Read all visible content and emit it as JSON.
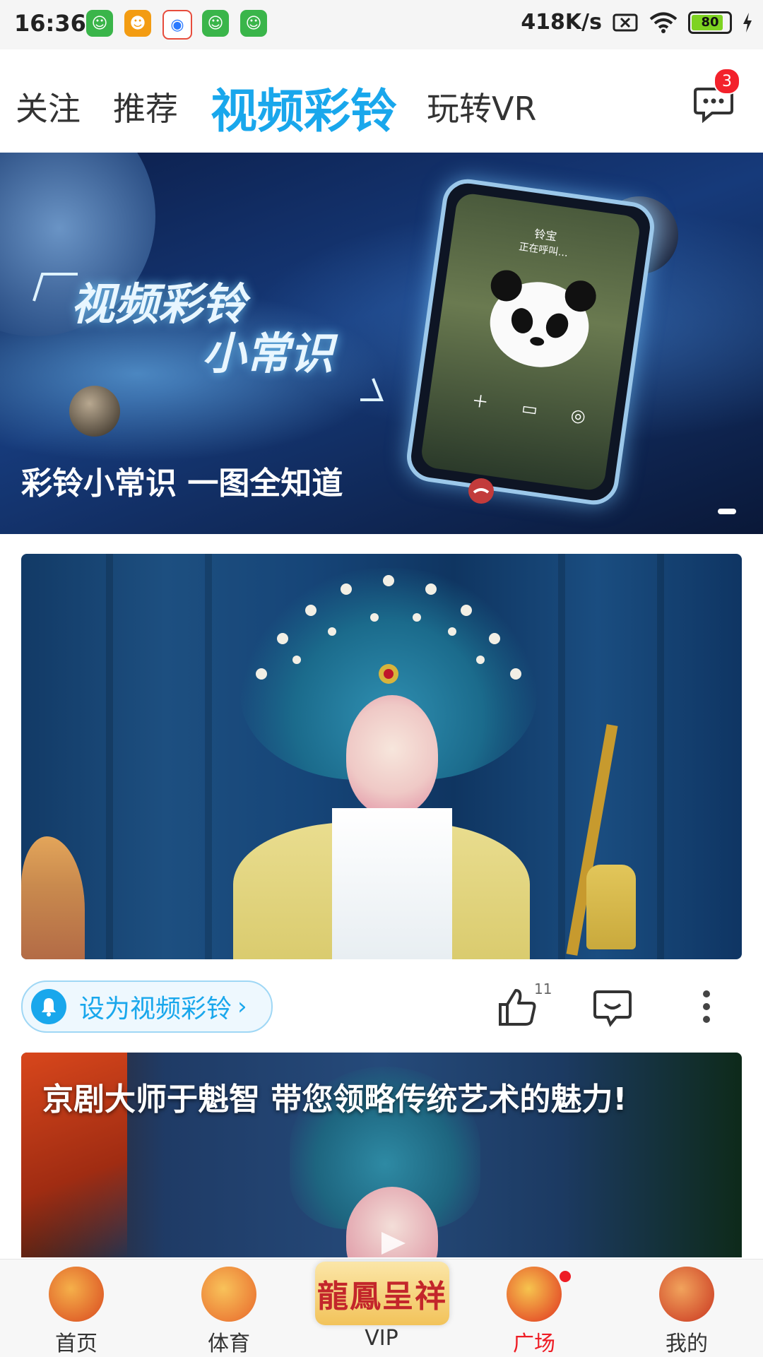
{
  "status_bar": {
    "time": "16:36",
    "net_speed": "418K/s",
    "battery": "80"
  },
  "tabs": [
    {
      "label": "关注"
    },
    {
      "label": "推荐"
    },
    {
      "label": "视频彩铃"
    },
    {
      "label": "玩转VR"
    }
  ],
  "messages": {
    "badge": "3"
  },
  "banner": {
    "title_line1": "视频彩铃",
    "title_line2": "小常识",
    "caption": "彩铃小常识 一图全知道",
    "phone_caller": "铃宝",
    "phone_status": "正在呼叫…"
  },
  "card1": {
    "ringtone_button": "设为视频彩铃",
    "like_count": "11"
  },
  "card2": {
    "title": "京剧大师于魁智 带您领略传统艺术的魅力!"
  },
  "bottom_nav": [
    {
      "label": "首页"
    },
    {
      "label": "体育"
    },
    {
      "label": "VIP",
      "logo_text": "龍鳳呈祥"
    },
    {
      "label": "广场"
    },
    {
      "label": "我的"
    }
  ],
  "colors": {
    "accent": "#19a7ec",
    "active_nav": "#ee1d25",
    "badge": "#f3212b"
  }
}
